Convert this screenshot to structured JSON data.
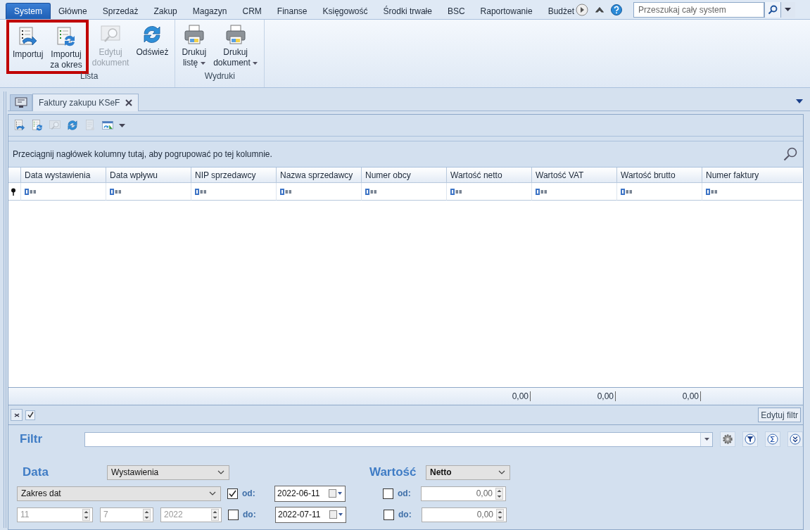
{
  "menu_tabs": [
    {
      "label": "System",
      "selected": true
    },
    {
      "label": "Główne",
      "selected": false
    },
    {
      "label": "Sprzedaż",
      "selected": false
    },
    {
      "label": "Zakup",
      "selected": false
    },
    {
      "label": "Magazyn",
      "selected": false
    },
    {
      "label": "CRM",
      "selected": false
    },
    {
      "label": "Finanse",
      "selected": false
    },
    {
      "label": "Księgowość",
      "selected": false
    },
    {
      "label": "Środki trwałe",
      "selected": false
    },
    {
      "label": "BSC",
      "selected": false
    },
    {
      "label": "Raportowanie",
      "selected": false
    },
    {
      "label": "Budżet",
      "selected": false
    }
  ],
  "search": {
    "placeholder": "Przeszukaj cały system"
  },
  "ribbon": {
    "groups": [
      {
        "label": "Lista",
        "buttons": [
          {
            "kind": "import",
            "lines": [
              "Importuj"
            ],
            "disabled": false,
            "dropdown": false,
            "highlighted": true
          },
          {
            "kind": "import-period",
            "lines": [
              "Importuj",
              "za okres"
            ],
            "disabled": false,
            "dropdown": false,
            "highlighted": true
          },
          {
            "kind": "edit",
            "lines": [
              "Edytuj",
              "dokument"
            ],
            "disabled": true,
            "dropdown": false,
            "highlighted": false
          },
          {
            "kind": "refresh",
            "lines": [
              "Odśwież"
            ],
            "disabled": false,
            "dropdown": false,
            "highlighted": false
          }
        ]
      },
      {
        "label": "Wydruki",
        "buttons": [
          {
            "kind": "print",
            "lines": [
              "Drukuj",
              "listę"
            ],
            "disabled": false,
            "dropdown": true,
            "highlighted": false
          },
          {
            "kind": "print",
            "lines": [
              "Drukuj",
              "dokument"
            ],
            "disabled": false,
            "dropdown": true,
            "highlighted": false
          }
        ]
      }
    ]
  },
  "document_tabs": [
    {
      "label": "Faktury zakupu KSeF",
      "selected": true
    }
  ],
  "toolbar": [
    {
      "kind": "import",
      "disabled": false
    },
    {
      "kind": "import-period",
      "disabled": false
    },
    {
      "kind": "edit",
      "disabled": true
    },
    {
      "kind": "refresh",
      "disabled": false
    },
    {
      "kind": "document",
      "disabled": true
    },
    {
      "kind": "export",
      "disabled": false
    }
  ],
  "grid": {
    "group_hint": "Przeciągnij nagłówek kolumny tutaj, aby pogrupować po tej kolumnie.",
    "columns": [
      {
        "label": "Data wystawienia"
      },
      {
        "label": "Data wpływu"
      },
      {
        "label": "NIP sprzedawcy"
      },
      {
        "label": "Nazwa sprzedawcy"
      },
      {
        "label": "Numer obcy"
      },
      {
        "label": "Wartość netto",
        "total": "0,00"
      },
      {
        "label": "Wartość VAT",
        "total": "0,00"
      },
      {
        "label": "Wartość brutto",
        "total": "0,00"
      },
      {
        "label": "Numer faktury"
      }
    ]
  },
  "filter_bar": {
    "button": "Edytuj filtr",
    "checked": true
  },
  "filter": {
    "label": "Filtr"
  },
  "date": {
    "label": "Data",
    "type": "Wystawienia",
    "range": "Zakres dat",
    "from": {
      "label": "od:",
      "checked": true,
      "value": "2022-06-11"
    },
    "to": {
      "label": "do:",
      "checked": false,
      "value": "2022-07-11"
    },
    "parts": [
      {
        "value": "11",
        "disabled": true
      },
      {
        "value": "7",
        "disabled": true
      },
      {
        "value": "2022",
        "disabled": true
      }
    ]
  },
  "amount": {
    "label": "Wartość",
    "type": "Netto",
    "from": {
      "label": "od:",
      "checked": false,
      "value": "0,00"
    },
    "to": {
      "label": "do:",
      "checked": false,
      "value": "0,00"
    }
  }
}
